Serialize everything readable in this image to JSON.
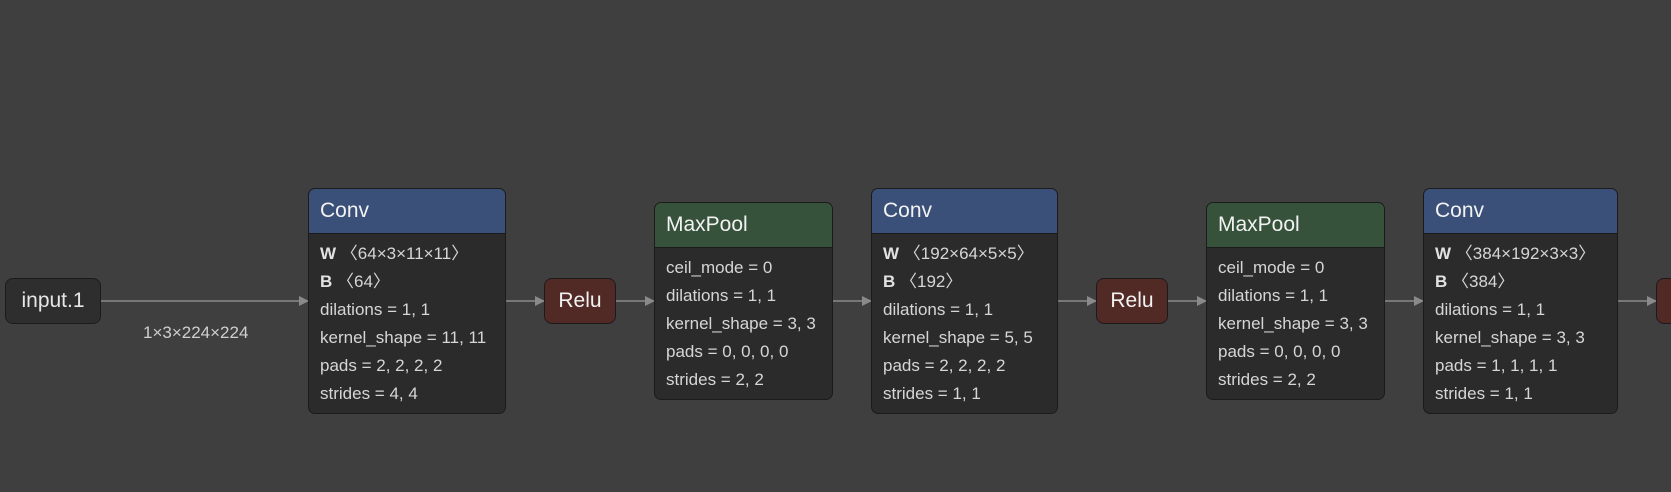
{
  "colors": {
    "background": "#3f3f3f",
    "conv_header": "#3a5078",
    "pool_header": "#36523a",
    "relu_fill": "#512a25",
    "node_body": "#2b2b2b",
    "edge": "#8a8a8a"
  },
  "input": {
    "label": "input.1",
    "edge_label": "1×3×224×224"
  },
  "conv1": {
    "title": "Conv",
    "w_key": "W",
    "w_val": "〈64×3×11×11〉",
    "b_key": "B",
    "b_val": "〈64〉",
    "attrs": [
      "dilations = 1, 1",
      "kernel_shape = 11, 11",
      "pads = 2, 2, 2, 2",
      "strides = 4, 4"
    ]
  },
  "relu1": {
    "label": "Relu"
  },
  "pool1": {
    "title": "MaxPool",
    "attrs": [
      "ceil_mode = 0",
      "dilations = 1, 1",
      "kernel_shape = 3, 3",
      "pads = 0, 0, 0, 0",
      "strides = 2, 2"
    ]
  },
  "conv2": {
    "title": "Conv",
    "w_key": "W",
    "w_val": "〈192×64×5×5〉",
    "b_key": "B",
    "b_val": "〈192〉",
    "attrs": [
      "dilations = 1, 1",
      "kernel_shape = 5, 5",
      "pads = 2, 2, 2, 2",
      "strides = 1, 1"
    ]
  },
  "relu2": {
    "label": "Relu"
  },
  "pool2": {
    "title": "MaxPool",
    "attrs": [
      "ceil_mode = 0",
      "dilations = 1, 1",
      "kernel_shape = 3, 3",
      "pads = 0, 0, 0, 0",
      "strides = 2, 2"
    ]
  },
  "conv3": {
    "title": "Conv",
    "w_key": "W",
    "w_val": "〈384×192×3×3〉",
    "b_key": "B",
    "b_val": "〈384〉",
    "attrs": [
      "dilations = 1, 1",
      "kernel_shape = 3, 3",
      "pads = 1, 1, 1, 1",
      "strides = 1, 1"
    ]
  }
}
